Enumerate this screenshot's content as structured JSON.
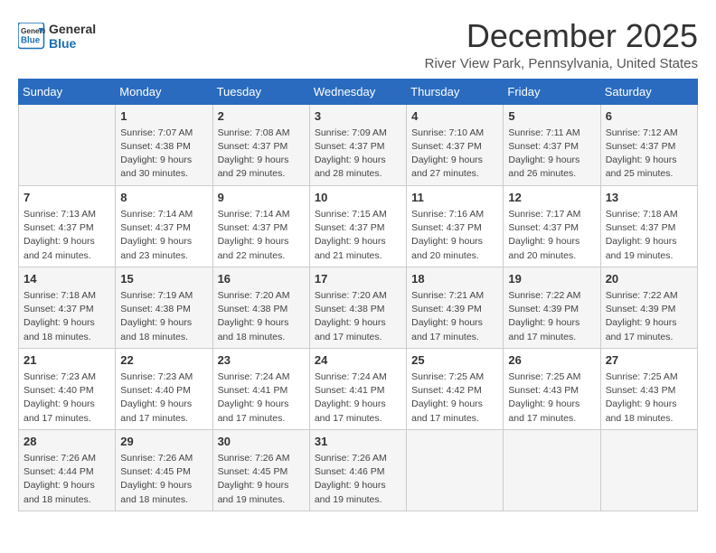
{
  "header": {
    "logo_line1": "General",
    "logo_line2": "Blue",
    "title": "December 2025",
    "subtitle": "River View Park, Pennsylvania, United States"
  },
  "calendar": {
    "days_of_week": [
      "Sunday",
      "Monday",
      "Tuesday",
      "Wednesday",
      "Thursday",
      "Friday",
      "Saturday"
    ],
    "weeks": [
      [
        {
          "day": "",
          "content": ""
        },
        {
          "day": "1",
          "content": "Sunrise: 7:07 AM\nSunset: 4:38 PM\nDaylight: 9 hours\nand 30 minutes."
        },
        {
          "day": "2",
          "content": "Sunrise: 7:08 AM\nSunset: 4:37 PM\nDaylight: 9 hours\nand 29 minutes."
        },
        {
          "day": "3",
          "content": "Sunrise: 7:09 AM\nSunset: 4:37 PM\nDaylight: 9 hours\nand 28 minutes."
        },
        {
          "day": "4",
          "content": "Sunrise: 7:10 AM\nSunset: 4:37 PM\nDaylight: 9 hours\nand 27 minutes."
        },
        {
          "day": "5",
          "content": "Sunrise: 7:11 AM\nSunset: 4:37 PM\nDaylight: 9 hours\nand 26 minutes."
        },
        {
          "day": "6",
          "content": "Sunrise: 7:12 AM\nSunset: 4:37 PM\nDaylight: 9 hours\nand 25 minutes."
        }
      ],
      [
        {
          "day": "7",
          "content": "Sunrise: 7:13 AM\nSunset: 4:37 PM\nDaylight: 9 hours\nand 24 minutes."
        },
        {
          "day": "8",
          "content": "Sunrise: 7:14 AM\nSunset: 4:37 PM\nDaylight: 9 hours\nand 23 minutes."
        },
        {
          "day": "9",
          "content": "Sunrise: 7:14 AM\nSunset: 4:37 PM\nDaylight: 9 hours\nand 22 minutes."
        },
        {
          "day": "10",
          "content": "Sunrise: 7:15 AM\nSunset: 4:37 PM\nDaylight: 9 hours\nand 21 minutes."
        },
        {
          "day": "11",
          "content": "Sunrise: 7:16 AM\nSunset: 4:37 PM\nDaylight: 9 hours\nand 20 minutes."
        },
        {
          "day": "12",
          "content": "Sunrise: 7:17 AM\nSunset: 4:37 PM\nDaylight: 9 hours\nand 20 minutes."
        },
        {
          "day": "13",
          "content": "Sunrise: 7:18 AM\nSunset: 4:37 PM\nDaylight: 9 hours\nand 19 minutes."
        }
      ],
      [
        {
          "day": "14",
          "content": "Sunrise: 7:18 AM\nSunset: 4:37 PM\nDaylight: 9 hours\nand 18 minutes."
        },
        {
          "day": "15",
          "content": "Sunrise: 7:19 AM\nSunset: 4:38 PM\nDaylight: 9 hours\nand 18 minutes."
        },
        {
          "day": "16",
          "content": "Sunrise: 7:20 AM\nSunset: 4:38 PM\nDaylight: 9 hours\nand 18 minutes."
        },
        {
          "day": "17",
          "content": "Sunrise: 7:20 AM\nSunset: 4:38 PM\nDaylight: 9 hours\nand 17 minutes."
        },
        {
          "day": "18",
          "content": "Sunrise: 7:21 AM\nSunset: 4:39 PM\nDaylight: 9 hours\nand 17 minutes."
        },
        {
          "day": "19",
          "content": "Sunrise: 7:22 AM\nSunset: 4:39 PM\nDaylight: 9 hours\nand 17 minutes."
        },
        {
          "day": "20",
          "content": "Sunrise: 7:22 AM\nSunset: 4:39 PM\nDaylight: 9 hours\nand 17 minutes."
        }
      ],
      [
        {
          "day": "21",
          "content": "Sunrise: 7:23 AM\nSunset: 4:40 PM\nDaylight: 9 hours\nand 17 minutes."
        },
        {
          "day": "22",
          "content": "Sunrise: 7:23 AM\nSunset: 4:40 PM\nDaylight: 9 hours\nand 17 minutes."
        },
        {
          "day": "23",
          "content": "Sunrise: 7:24 AM\nSunset: 4:41 PM\nDaylight: 9 hours\nand 17 minutes."
        },
        {
          "day": "24",
          "content": "Sunrise: 7:24 AM\nSunset: 4:41 PM\nDaylight: 9 hours\nand 17 minutes."
        },
        {
          "day": "25",
          "content": "Sunrise: 7:25 AM\nSunset: 4:42 PM\nDaylight: 9 hours\nand 17 minutes."
        },
        {
          "day": "26",
          "content": "Sunrise: 7:25 AM\nSunset: 4:43 PM\nDaylight: 9 hours\nand 17 minutes."
        },
        {
          "day": "27",
          "content": "Sunrise: 7:25 AM\nSunset: 4:43 PM\nDaylight: 9 hours\nand 18 minutes."
        }
      ],
      [
        {
          "day": "28",
          "content": "Sunrise: 7:26 AM\nSunset: 4:44 PM\nDaylight: 9 hours\nand 18 minutes."
        },
        {
          "day": "29",
          "content": "Sunrise: 7:26 AM\nSunset: 4:45 PM\nDaylight: 9 hours\nand 18 minutes."
        },
        {
          "day": "30",
          "content": "Sunrise: 7:26 AM\nSunset: 4:45 PM\nDaylight: 9 hours\nand 19 minutes."
        },
        {
          "day": "31",
          "content": "Sunrise: 7:26 AM\nSunset: 4:46 PM\nDaylight: 9 hours\nand 19 minutes."
        },
        {
          "day": "",
          "content": ""
        },
        {
          "day": "",
          "content": ""
        },
        {
          "day": "",
          "content": ""
        }
      ]
    ]
  }
}
